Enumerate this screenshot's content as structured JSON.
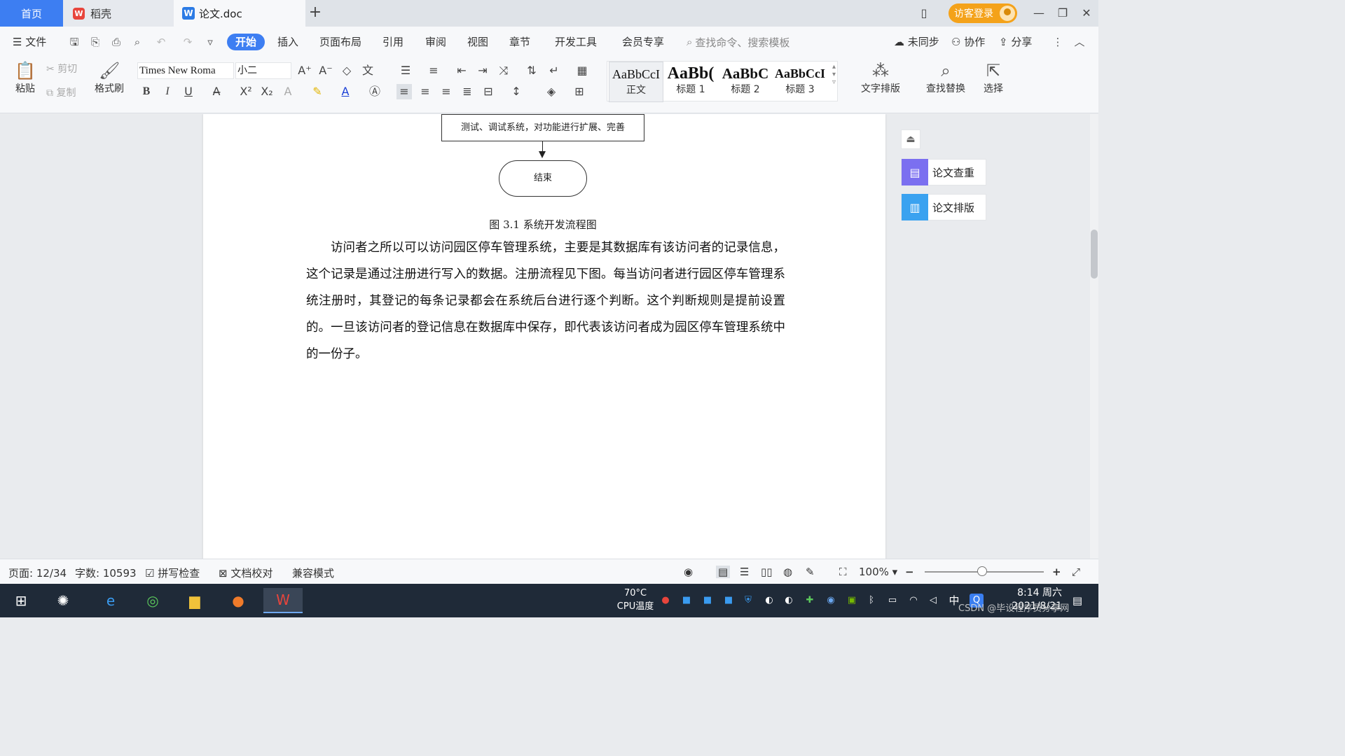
{
  "tabs": {
    "home": "首页",
    "wps": "稻壳",
    "doc": "论文.doc",
    "add": "+"
  },
  "titlebar": {
    "guest_login": "访客登录"
  },
  "menu": {
    "file": "文件",
    "items": [
      "开始",
      "插入",
      "页面布局",
      "引用",
      "审阅",
      "视图",
      "章节",
      "开发工具",
      "会员专享"
    ],
    "search_placeholder": "查找命令、搜索模板",
    "sync": "未同步",
    "collab": "协作",
    "share": "分享"
  },
  "ribbon": {
    "paste": "粘贴",
    "cut": "剪切",
    "copy": "复制",
    "format_painter": "格式刷",
    "font_name": "Times New Roma",
    "font_size": "小二",
    "styles": [
      {
        "preview": "AaBbCcI",
        "name": "正文"
      },
      {
        "preview": "AaBb(",
        "name": "标题 1"
      },
      {
        "preview": "AaBbC",
        "name": "标题 2"
      },
      {
        "preview": "AaBbCcI",
        "name": "标题 3"
      }
    ],
    "text_layout": "文字排版",
    "find_replace": "查找替换",
    "select": "选择"
  },
  "document": {
    "flow_step": "测试、调试系统，对功能进行扩展、完善",
    "flow_end": "结束",
    "figure_caption": "图 3.1 系统开发流程图",
    "paragraph": "访问者之所以可以访问园区停车管理系统，主要是其数据库有该访问者的记录信息，这个记录是通过注册进行写入的数据。注册流程见下图。每当访问者进行园区停车管理系统注册时，其登记的每条记录都会在系统后台进行逐个判断。这个判断规则是提前设置的。一旦该访问者的登记信息在数据库中保存，即代表该访问者成为园区停车管理系统中的一份子。"
  },
  "side_panel": {
    "check": "论文查重",
    "format": "论文排版"
  },
  "status": {
    "page": "页面: 12/34",
    "words": "字数: 10593",
    "spell_check": "拼写检查",
    "proofread": "文档校对",
    "compat": "兼容模式",
    "zoom": "100%"
  },
  "taskbar": {
    "temp": "70°C",
    "cpu_label": "CPU温度",
    "ime": "中",
    "time": "8:14 周六",
    "date": "2021/8/21",
    "watermark": "CSDN @毕设程序员分享网"
  },
  "colors": {
    "accent": "#3d7ef2",
    "guest": "#f4a21a",
    "check_icon": "#7b6ff0",
    "format_icon": "#3aa2f0"
  }
}
